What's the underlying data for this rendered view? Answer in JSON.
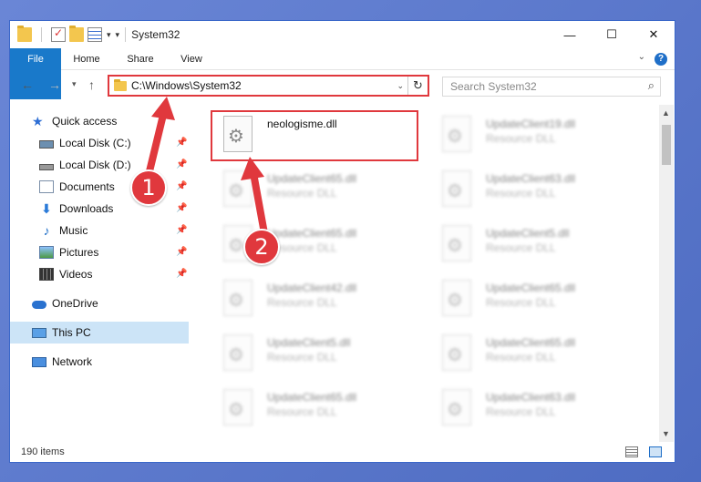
{
  "window": {
    "title": "System32",
    "minimize_glyph": "—",
    "maximize_glyph": "☐",
    "close_glyph": "✕"
  },
  "ribbon": {
    "tabs": [
      "File",
      "Home",
      "Share",
      "View"
    ],
    "expand_glyph": "⌄",
    "help_glyph": "?"
  },
  "nav": {
    "back_glyph": "←",
    "forward_glyph": "→",
    "recent_glyph": "▾",
    "up_glyph": "↑",
    "address_path": "C:\\Windows\\System32",
    "address_dropdown_glyph": "⌄",
    "refresh_glyph": "↻",
    "search_placeholder": "Search System32",
    "search_glyph": "⌕"
  },
  "sidebar": {
    "items": [
      {
        "label": "Quick access",
        "icon": "star-icon",
        "pinned": false
      },
      {
        "label": "Local Disk (C:)",
        "icon": "drive-icon",
        "pinned": true
      },
      {
        "label": "Local Disk (D:)",
        "icon": "drive-icon",
        "pinned": true
      },
      {
        "label": "Documents",
        "icon": "documents-icon",
        "pinned": true
      },
      {
        "label": "Downloads",
        "icon": "downloads-icon",
        "pinned": true
      },
      {
        "label": "Music",
        "icon": "music-icon",
        "pinned": true
      },
      {
        "label": "Pictures",
        "icon": "pictures-icon",
        "pinned": true
      },
      {
        "label": "Videos",
        "icon": "videos-icon",
        "pinned": true
      },
      {
        "label": "OneDrive",
        "icon": "onedrive-icon",
        "pinned": false
      },
      {
        "label": "This PC",
        "icon": "this-pc-icon",
        "pinned": false,
        "selected": true
      },
      {
        "label": "Network",
        "icon": "network-icon",
        "pinned": false
      }
    ],
    "pin_glyph": "📌"
  },
  "files": {
    "highlighted": {
      "name": "neologisme.dll",
      "type": ""
    },
    "items": [
      {
        "name": "UpdateClient19.dll",
        "type": "Resource DLL"
      },
      {
        "name": "UpdateClient65.dll",
        "type": "Resource DLL"
      },
      {
        "name": "UpdateClient63.dll",
        "type": "Resource DLL"
      },
      {
        "name": "UpdateClient65.dll",
        "type": "Resource DLL"
      },
      {
        "name": "UpdateClient5.dll",
        "type": "Resource DLL"
      },
      {
        "name": "UpdateClient42.dll",
        "type": "Resource DLL"
      },
      {
        "name": "UpdateClient65.dll",
        "type": "Resource DLL"
      },
      {
        "name": "UpdateClient5.dll",
        "type": "Resource DLL"
      },
      {
        "name": "UpdateClient65.dll",
        "type": "Resource DLL"
      },
      {
        "name": "UpdateClient65.dll",
        "type": "Resource DLL"
      },
      {
        "name": "UpdateClient63.dll",
        "type": "Resource DLL"
      }
    ]
  },
  "status": {
    "item_count": "190 items"
  },
  "annotations": {
    "step1": "1",
    "step2": "2",
    "color": "#e0383d"
  }
}
